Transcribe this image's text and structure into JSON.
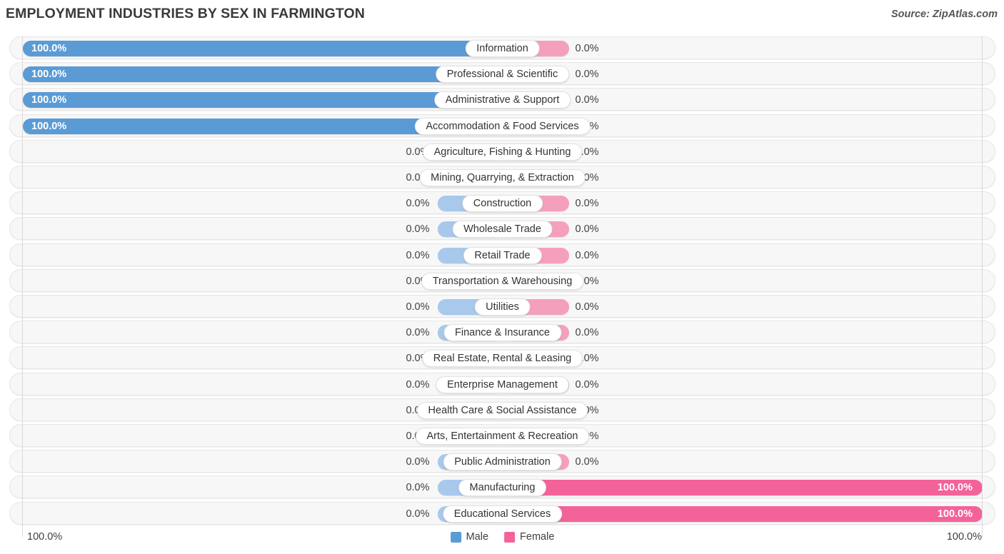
{
  "header": {
    "title": "EMPLOYMENT INDUSTRIES BY SEX IN FARMINGTON",
    "source": "Source: ZipAtlas.com"
  },
  "footer": {
    "axis_left": "100.0%",
    "axis_right": "100.0%",
    "legend": [
      {
        "label": "Male",
        "color": "#5b9bd5"
      },
      {
        "label": "Female",
        "color": "#f4629a"
      }
    ]
  },
  "colors": {
    "male": "#5b9bd5",
    "male_zero": "#a8c8ec",
    "female": "#f4629a",
    "female_zero": "#f4a0bd",
    "track": "#f7f7f7"
  },
  "chart_data": {
    "type": "bar",
    "subtype": "diverging-bar",
    "title": "EMPLOYMENT INDUSTRIES BY SEX IN FARMINGTON",
    "xlabel": "",
    "ylabel": "",
    "xlim": [
      -100,
      100
    ],
    "axis_left_label": "100.0%",
    "axis_right_label": "100.0%",
    "grid": false,
    "legend_position": "bottom-center",
    "categories": [
      "Information",
      "Professional & Scientific",
      "Administrative & Support",
      "Accommodation & Food Services",
      "Agriculture, Fishing & Hunting",
      "Mining, Quarrying, & Extraction",
      "Construction",
      "Wholesale Trade",
      "Retail Trade",
      "Transportation & Warehousing",
      "Utilities",
      "Finance & Insurance",
      "Real Estate, Rental & Leasing",
      "Enterprise Management",
      "Health Care & Social Assistance",
      "Arts, Entertainment & Recreation",
      "Public Administration",
      "Manufacturing",
      "Educational Services"
    ],
    "series": [
      {
        "name": "Male",
        "color": "#5b9bd5",
        "values": [
          100.0,
          100.0,
          100.0,
          100.0,
          0.0,
          0.0,
          0.0,
          0.0,
          0.0,
          0.0,
          0.0,
          0.0,
          0.0,
          0.0,
          0.0,
          0.0,
          0.0,
          0.0,
          0.0
        ],
        "labels": [
          "100.0%",
          "100.0%",
          "100.0%",
          "100.0%",
          "0.0%",
          "0.0%",
          "0.0%",
          "0.0%",
          "0.0%",
          "0.0%",
          "0.0%",
          "0.0%",
          "0.0%",
          "0.0%",
          "0.0%",
          "0.0%",
          "0.0%",
          "0.0%",
          "0.0%"
        ]
      },
      {
        "name": "Female",
        "color": "#f4629a",
        "values": [
          0.0,
          0.0,
          0.0,
          0.0,
          0.0,
          0.0,
          0.0,
          0.0,
          0.0,
          0.0,
          0.0,
          0.0,
          0.0,
          0.0,
          0.0,
          0.0,
          0.0,
          100.0,
          100.0
        ],
        "labels": [
          "0.0%",
          "0.0%",
          "0.0%",
          "0.0%",
          "0.0%",
          "0.0%",
          "0.0%",
          "0.0%",
          "0.0%",
          "0.0%",
          "0.0%",
          "0.0%",
          "0.0%",
          "0.0%",
          "0.0%",
          "0.0%",
          "0.0%",
          "100.0%",
          "100.0%"
        ]
      }
    ]
  }
}
